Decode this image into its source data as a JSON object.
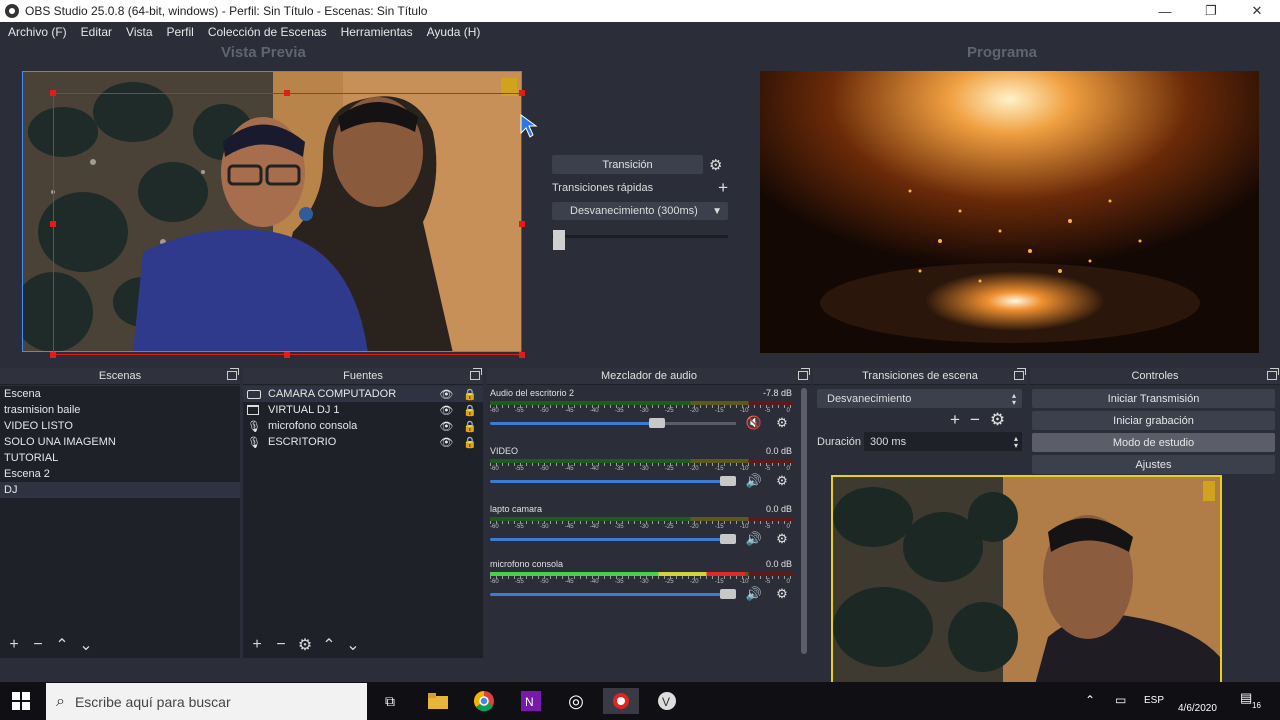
{
  "window": {
    "title": "OBS Studio 25.0.8 (64-bit, windows) - Perfil: Sin Título - Escenas: Sin Título"
  },
  "menu": [
    "Archivo (F)",
    "Editar",
    "Vista",
    "Perfil",
    "Colección de Escenas",
    "Herramientas",
    "Ayuda (H)"
  ],
  "preview_label": "Vista Previa",
  "program_label": "Programa",
  "transition": {
    "button": "Transición",
    "quick": "Transiciones rápidas",
    "selected": "Desvanecimiento (300ms)"
  },
  "docks": {
    "scenes": "Escenas",
    "sources": "Fuentes",
    "mixer": "Mezclador de audio",
    "scene_transitions": "Transiciones de escena",
    "controls": "Controles"
  },
  "scenes": [
    "Escena",
    "trasmision baile",
    "VIDEO LISTO",
    "SOLO UNA IMAGEMN",
    "TUTORIAL",
    "Escena 2",
    "DJ"
  ],
  "sources": [
    {
      "name": "CAMARA COMPUTADOR",
      "icon": "camera-icon"
    },
    {
      "name": "VIRTUAL DJ 1",
      "icon": "window-icon"
    },
    {
      "name": "microfono consola",
      "icon": "mic-icon"
    },
    {
      "name": "ESCRITORIO",
      "icon": "mic-icon"
    }
  ],
  "mixer": {
    "ticks": [
      "-60",
      "-55",
      "-50",
      "-45",
      "-40",
      "-35",
      "-30",
      "-25",
      "-20",
      "-15",
      "-10",
      "-5",
      "0"
    ],
    "channels": [
      {
        "name": "Audio del escritorio 2",
        "db": "-7.8 dB",
        "level": 0.0,
        "volume": 0.69,
        "muted": true
      },
      {
        "name": "VIDEO",
        "db": "0.0 dB",
        "level": 0.0,
        "volume": 1.0,
        "muted": false
      },
      {
        "name": "lapto camara",
        "db": "0.0 dB",
        "level": 0.0,
        "volume": 1.0,
        "muted": false
      },
      {
        "name": "microfono consola",
        "db": "0.0 dB",
        "level": 0.84,
        "volume": 1.0,
        "muted": false
      }
    ]
  },
  "scene_transition": {
    "selected": "Desvanecimiento",
    "duration_label": "Duración",
    "duration": "300 ms"
  },
  "controls": [
    "Iniciar Transmisión",
    "Iniciar grabación",
    "Modo de estudio",
    "Ajustes"
  ],
  "taskbar": {
    "search_placeholder": "Escribe aquí para buscar",
    "lang": "ESP",
    "date": "4/6/2020",
    "notifications": "16"
  },
  "colors": {
    "accent": "#3f8cff",
    "selection": "#e21b1b",
    "studio_border": "#e6d21e"
  }
}
